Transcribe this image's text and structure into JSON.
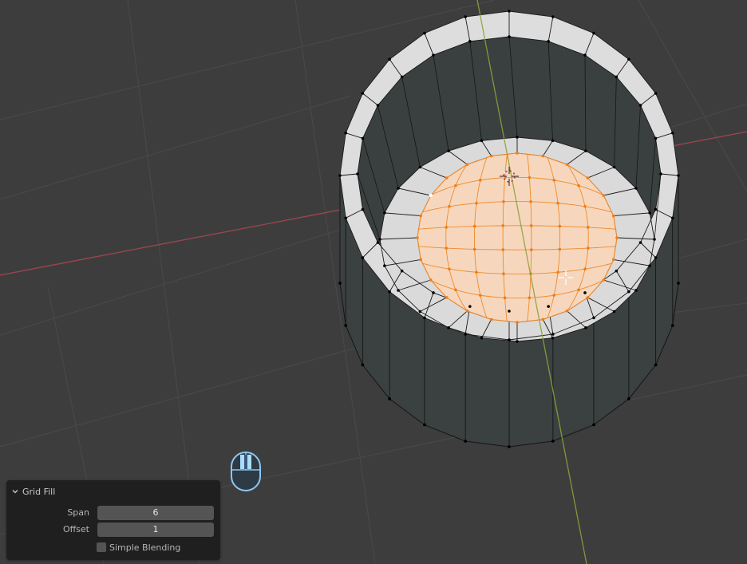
{
  "operator_panel": {
    "title": "Grid Fill",
    "fields": [
      {
        "label": "Span",
        "value": "6"
      },
      {
        "label": "Offset",
        "value": "1"
      }
    ],
    "checkbox": {
      "label": "Simple Blending",
      "checked": false
    }
  },
  "colors": {
    "viewport_bg": "#3d3d3d",
    "grid_line": "#4a4a4a",
    "x_axis": "#9a4550",
    "y_axis": "#8aa23a",
    "mesh_face": "#dcdcdc",
    "mesh_wall": "#3e4444",
    "selection": "#f08a2c",
    "panel_bg": "#1f1f1f"
  },
  "icons": [
    "mouse-left-click-icon",
    "chevron-down-icon",
    "3d-cursor-icon",
    "crosshair-cursor-icon"
  ]
}
